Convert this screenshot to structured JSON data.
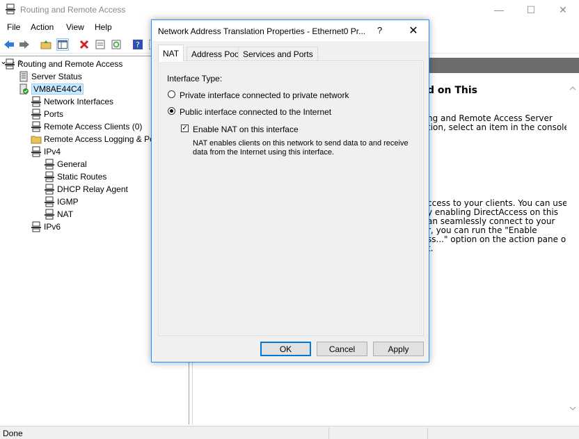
{
  "window": {
    "title": "Routing and Remote Access",
    "minimize_glyph": "—",
    "maximize_glyph": "☐",
    "close_glyph": "✕"
  },
  "menu": [
    "File",
    "Action",
    "View",
    "Help"
  ],
  "toolbar": {
    "icons": [
      "back-arrow-icon",
      "forward-arrow-icon",
      "up-folder-icon",
      "show-hide-tree-icon",
      "delete-icon",
      "properties-icon",
      "refresh-icon",
      "help-icon",
      "console-icon"
    ]
  },
  "tree": {
    "root": "Routing and Remote Access",
    "server_status": "Server Status",
    "server": "VM8AE44C4",
    "items": [
      "Network Interfaces",
      "Ports",
      "Remote Access Clients (0)",
      "Remote Access Logging & Po"
    ],
    "ipv4": "IPv4",
    "ipv4_children": [
      "General",
      "Static Routes",
      "DHCP Relay Agent",
      "IGMP",
      "NAT"
    ],
    "ipv6": "IPv6"
  },
  "right_pane": {
    "heading_fragment": "d on This",
    "lines_a": [
      "ng and Remote Access Server",
      "tion, select an item in the console"
    ],
    "lines_b": [
      "ccess to your clients. You can use",
      "y enabling DirectAccess on this",
      "an seamlessly connect to your",
      "r, you can run the \"Enable",
      "ss...\" option on the action pane on",
      "t."
    ]
  },
  "status": {
    "text": "Done"
  },
  "dialog": {
    "title": "Network Address Translation Properties - Ethernet0 Pr...",
    "help_glyph": "?",
    "close_glyph": "✕",
    "tabs": [
      "NAT",
      "Address Pool",
      "Services and Ports"
    ],
    "interface_type_label": "Interface Type:",
    "radio_private": "Private interface connected to private network",
    "radio_public": "Public interface connected to the Internet",
    "selected_radio": "public",
    "checkbox_label": "Enable NAT on this interface",
    "checkbox_checked": true,
    "checkbox_glyph": "✓",
    "description": [
      "NAT enables clients on this network to send data to and receive",
      "data from the Internet using this interface."
    ],
    "buttons": {
      "ok": "OK",
      "cancel": "Cancel",
      "apply": "Apply"
    }
  }
}
